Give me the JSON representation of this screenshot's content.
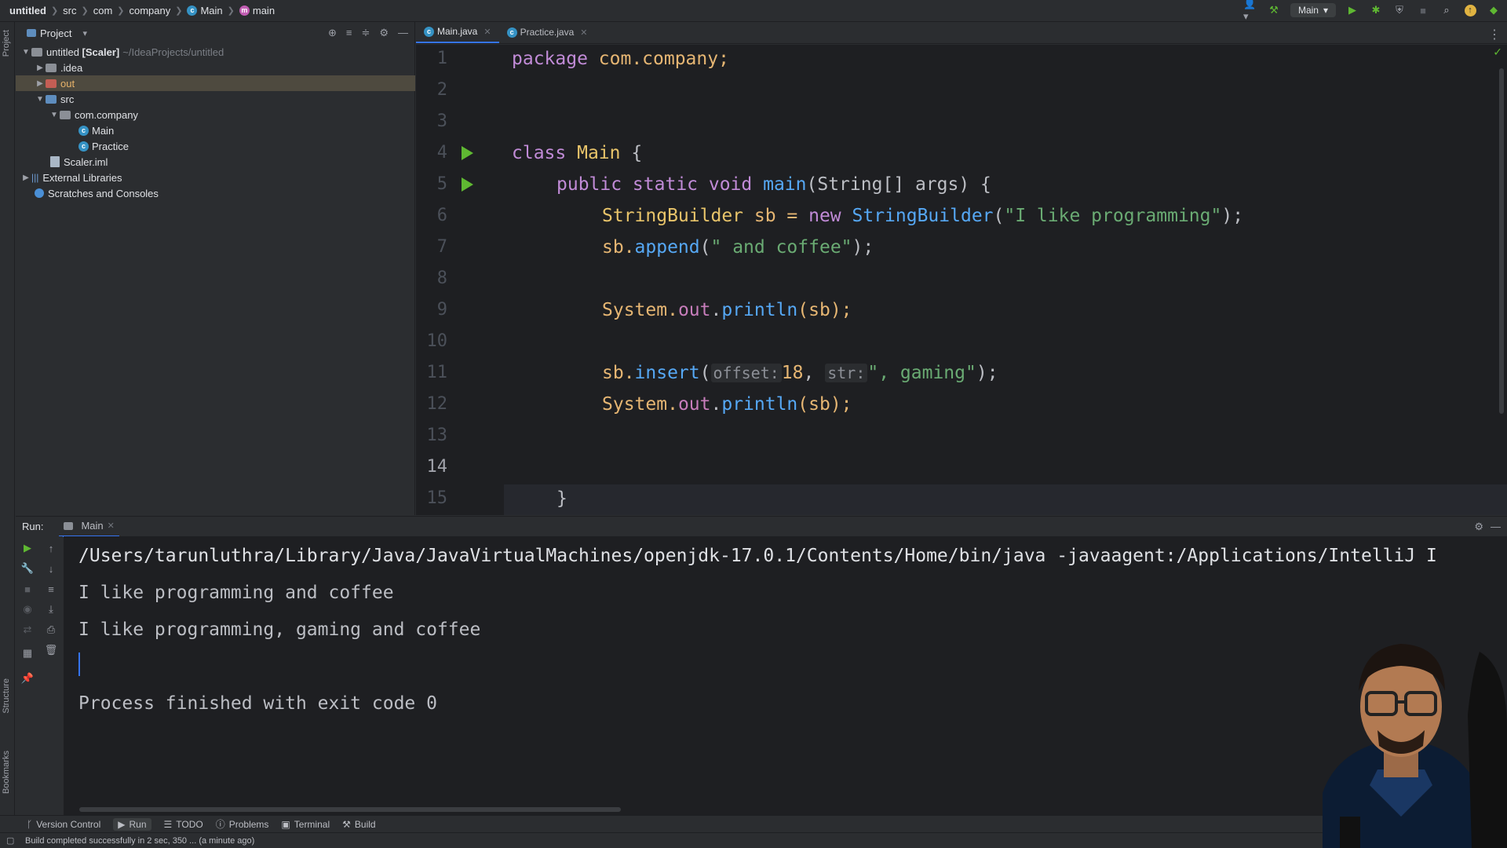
{
  "breadcrumbs": [
    "untitled",
    "src",
    "com",
    "company",
    "Main",
    "main"
  ],
  "toolbar": {
    "run_config": "Main"
  },
  "project": {
    "title": "Project",
    "root_name": "untitled",
    "root_module": "[Scaler]",
    "root_path": "~/IdeaProjects/untitled",
    "items": {
      "idea": ".idea",
      "out": "out",
      "src": "src",
      "package": "com.company",
      "main": "Main",
      "practice": "Practice",
      "iml": "Scaler.iml",
      "ext_libs": "External Libraries",
      "scratches": "Scratches and Consoles"
    }
  },
  "editor": {
    "tabs": [
      {
        "label": "Main.java"
      },
      {
        "label": "Practice.java"
      }
    ],
    "line_numbers": [
      "1",
      "2",
      "3",
      "4",
      "5",
      "6",
      "7",
      "8",
      "9",
      "10",
      "11",
      "12",
      "13",
      "14",
      "15"
    ],
    "code": {
      "l1_kw": "package",
      "l1_pkg": " com.company;",
      "l4_kw": "class",
      "l4_cls": " Main",
      "l4_punc": " {",
      "l5_kw": "public static void",
      "l5_fn": " main",
      "l5_rest": "(String[] args) {",
      "l6_type": "StringBuilder",
      "l6_var": " sb = ",
      "l6_new": "new",
      "l6_type2": " StringBuilder",
      "l6_p1": "(",
      "l6_str": "\"I like programming\"",
      "l6_p2": ");",
      "l7_var": "sb.",
      "l7_fn": "append",
      "l7_p1": "(",
      "l7_str": "\" and coffee\"",
      "l7_p2": ");",
      "l9_sys": "System.",
      "l9_out": "out",
      "l9_dot": ".",
      "l9_fn": "println",
      "l9_rest": "(sb);",
      "l11_var": "sb.",
      "l11_fn": "insert",
      "l11_p1": "(",
      "l11_hint1": "offset:",
      "l11_num": "18",
      "l11_comma": ", ",
      "l11_hint2": "str:",
      "l11_str": "\", gaming\"",
      "l11_p2": ");",
      "l12_sys": "System.",
      "l12_out": "out",
      "l12_dot": ".",
      "l12_fn": "println",
      "l12_rest": "(sb);",
      "l15_brace": "}"
    }
  },
  "run": {
    "label": "Run:",
    "tab": "Main",
    "output": [
      "/Users/tarunluthra/Library/Java/JavaVirtualMachines/openjdk-17.0.1/Contents/Home/bin/java -javaagent:/Applications/IntelliJ I",
      "I like programming and coffee",
      "I like programming, gaming and coffee",
      "Process finished with exit code 0"
    ]
  },
  "toolwindows": [
    "Version Control",
    "Run",
    "TODO",
    "Problems",
    "Terminal",
    "Build"
  ],
  "left_stripe": [
    "Project",
    "Structure",
    "Bookmarks"
  ],
  "status": {
    "message": "Build completed successfully in 2 sec, 350 ... (a minute ago)"
  },
  "colors": {
    "run_green": "#5fb832",
    "accent": "#3574f0"
  }
}
